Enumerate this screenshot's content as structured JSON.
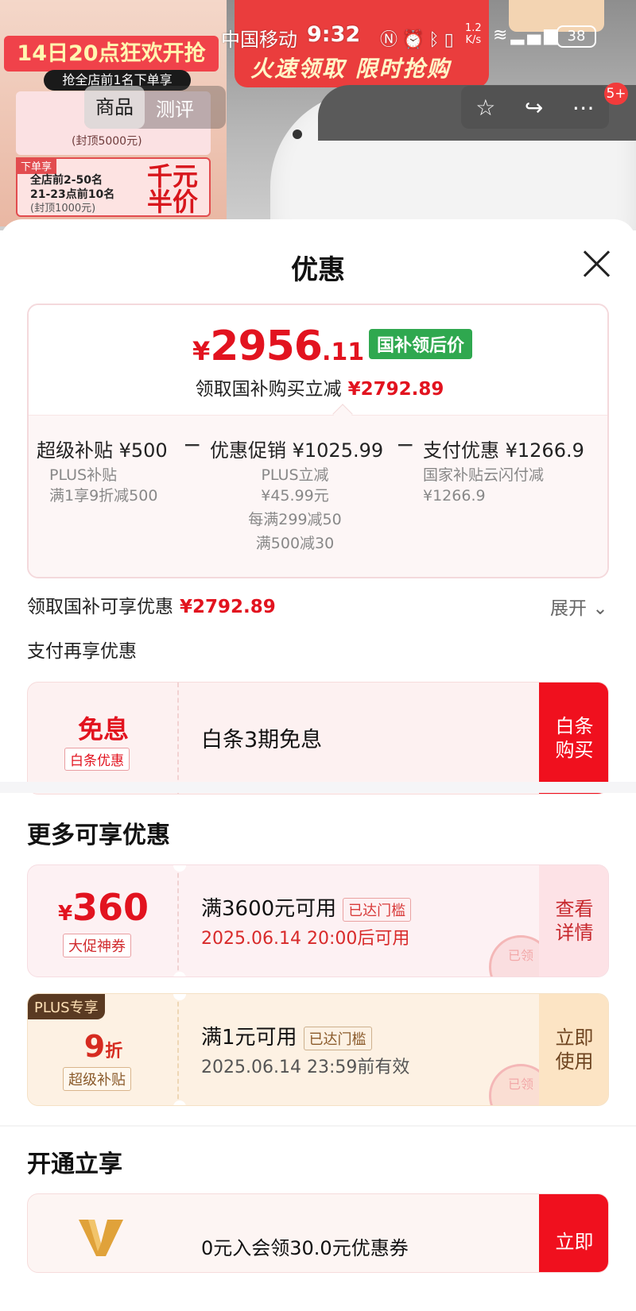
{
  "status_bar": {
    "carrier": "中国移动",
    "time": "9:32",
    "speed": "1.2\nK/s",
    "battery": "38"
  },
  "backdrop": {
    "promo_badge": "14日20点狂欢开抢",
    "promo_sub": "抢全店前1名下单享",
    "cap_text": "(封顶5000元)",
    "order_tag": "下单享",
    "order_text_1": "全店前2-50名",
    "order_text_2": "21-23点前10名",
    "order_text_3": "(封顶1000元)",
    "half_price_1": "千元",
    "half_price_2": "半价",
    "banner_text": "火速领取 限时抢购",
    "tabs": [
      "商品",
      "测评"
    ],
    "badge_count": "5+"
  },
  "sheet": {
    "title": "优惠",
    "price": {
      "symbol": "¥",
      "integer": "2956",
      "decimal": ".11",
      "tag": "国补领后价"
    },
    "subsidy_line": {
      "text": "领取国补购买立减",
      "amount": "¥2792.89"
    },
    "breakdown": {
      "items": [
        {
          "label": "超级补贴 ¥500",
          "details": [
            "PLUS补贴",
            "满1享9折减500"
          ]
        },
        {
          "label": "优惠促销 ¥1025.99",
          "details": [
            "PLUS立减",
            "¥45.99元",
            "每满299减50",
            "满500减30"
          ]
        },
        {
          "label": "支付优惠 ¥1266.9",
          "details": [
            "国家补贴云闪付减",
            "¥1266.9"
          ]
        }
      ],
      "operator": "−"
    },
    "claim_line": {
      "text": "领取国补可享优惠",
      "amount": "¥2792.89"
    },
    "expand_label": "展开",
    "pay_again": "支付再享优惠",
    "baitiao": {
      "big": "免息",
      "chip": "白条优惠",
      "text": "白条3期免息",
      "button": "白条购买"
    },
    "more_title": "更多可享优惠",
    "coupons": [
      {
        "symbol": "¥",
        "amount": "360",
        "chip": "大促神券",
        "condition": "满3600元可用",
        "status": "已达门槛",
        "time": "2025.06.14 20:00后可用",
        "stamp": "已领",
        "action": "查看详情"
      },
      {
        "plus_tag": "PLUS专享",
        "amount": "9",
        "unit": "折",
        "chip": "超级补贴",
        "condition": "满1元可用",
        "status": "已达门槛",
        "time": "2025.06.14 23:59前有效",
        "stamp": "已领",
        "action": "立即使用"
      }
    ],
    "open_title": "开通立享",
    "open_card": {
      "text": "0元入会领30.0元优惠券",
      "button": "立即"
    }
  }
}
